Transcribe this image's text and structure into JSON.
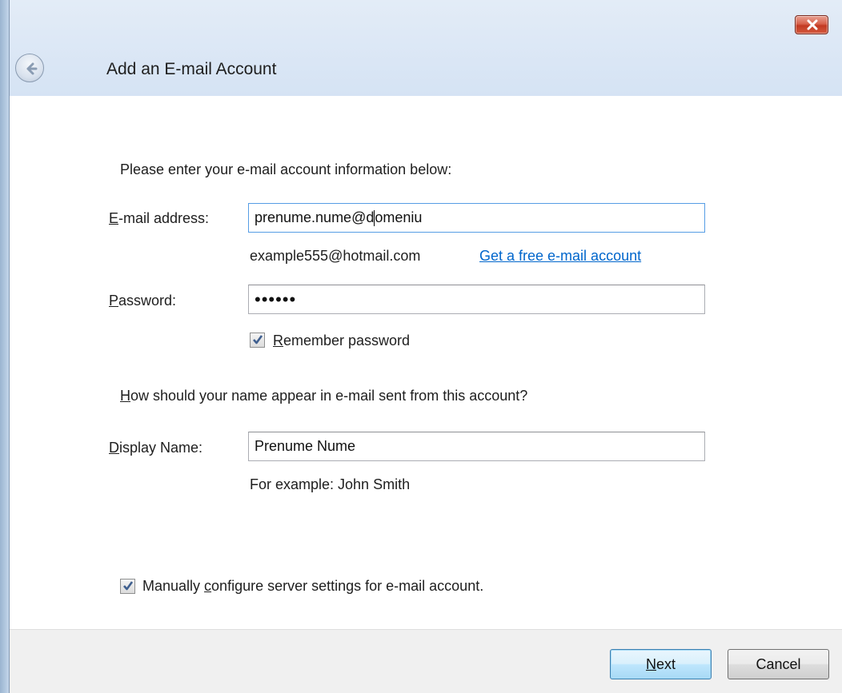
{
  "window": {
    "title": "Add an E-mail Account"
  },
  "form": {
    "intro": "Please enter your e-mail account information below:",
    "email": {
      "label_accel": "E",
      "label_rest": "-mail address:",
      "value_before_caret": "prenume.nume@d",
      "value_after_caret": "omeniu",
      "example": "example555@hotmail.com",
      "free_link": "Get a free e-mail account"
    },
    "password": {
      "label_accel": "P",
      "label_rest": "assword:",
      "masked_value": "••••••"
    },
    "remember": {
      "label_accel": "R",
      "label_rest": "emember password",
      "checked": true
    },
    "name_question": {
      "accel": "H",
      "rest": "ow should your name appear in e-mail sent from this account?"
    },
    "display_name": {
      "label_accel": "D",
      "label_rest": "isplay Name:",
      "value": "Prenume Nume",
      "example": "For example: John Smith"
    },
    "manual_config": {
      "label_before": "Manually ",
      "label_accel": "c",
      "label_after": "onfigure server settings for e-mail account.",
      "checked": true
    }
  },
  "footer": {
    "next_accel": "N",
    "next_rest": "ext",
    "cancel": "Cancel"
  },
  "colors": {
    "link": "#0066cc",
    "accent_border": "#3c7fb1",
    "close_red": "#c23a22"
  },
  "icons": {
    "close": "close-icon",
    "back": "back-arrow-icon",
    "check": "checkmark-icon"
  }
}
